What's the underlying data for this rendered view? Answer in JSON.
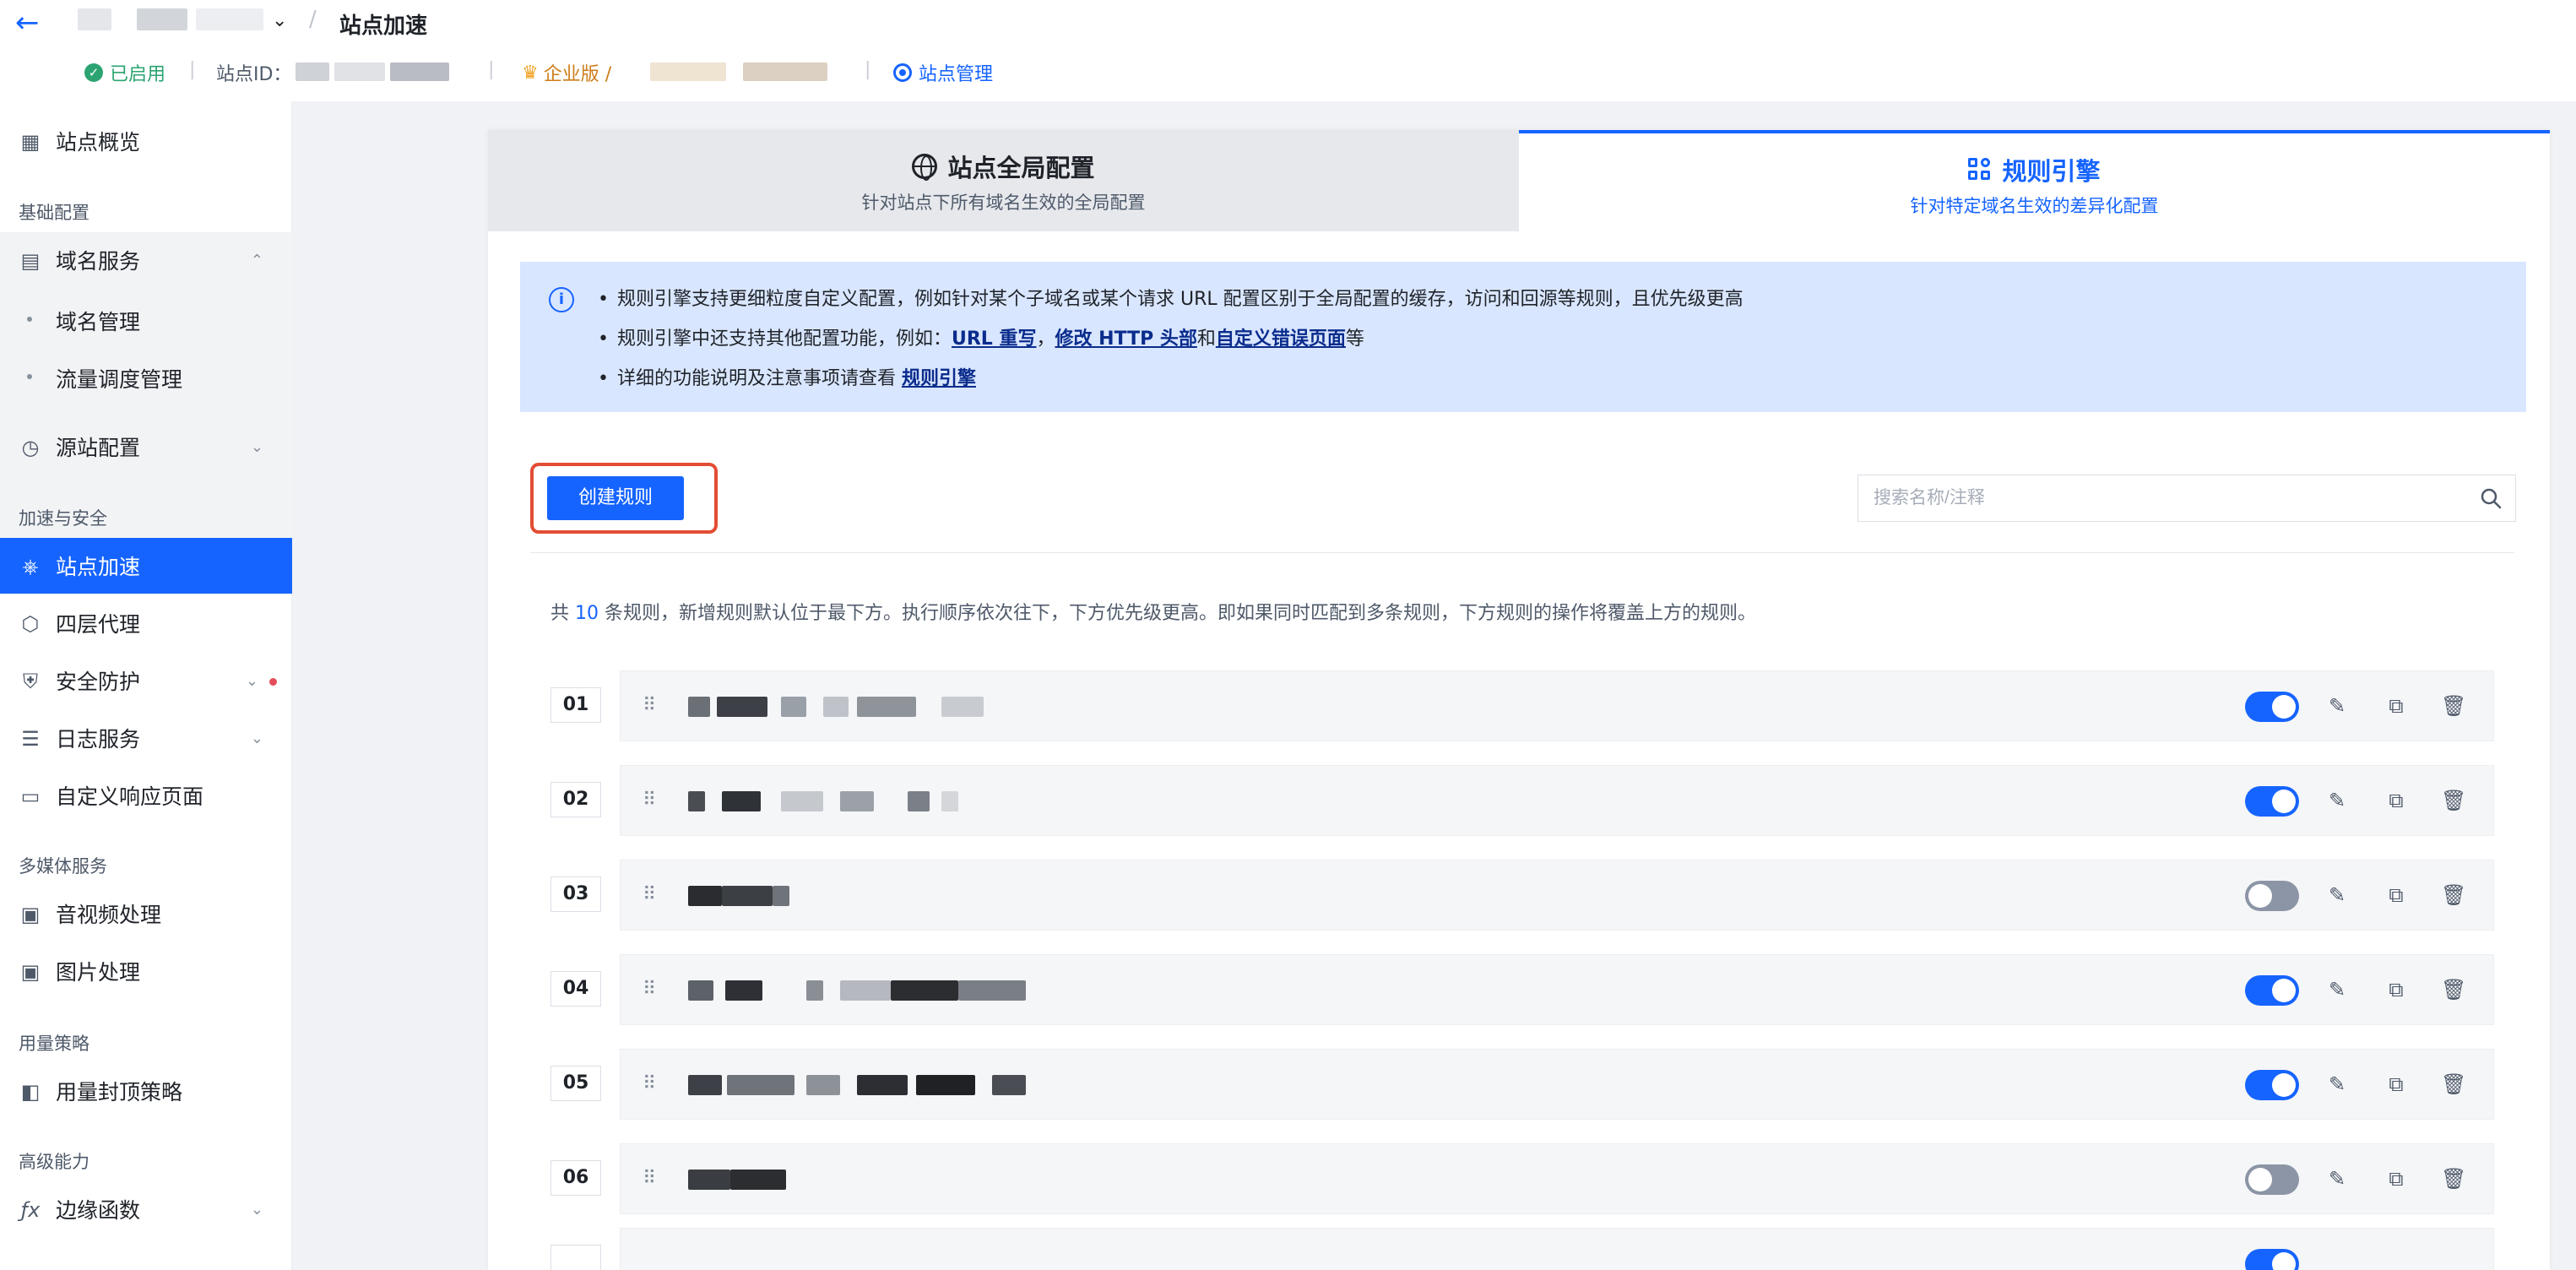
{
  "header": {
    "breadcrumb_separator": "/",
    "page_title": "站点加速",
    "status": "已启用",
    "site_id_label": "站点ID：",
    "edition": "企业版 /",
    "site_management": "站点管理",
    "meta_separator": "|"
  },
  "sidebar": {
    "overview": "站点概览",
    "group_basic": "基础配置",
    "domain_service": "域名服务",
    "domain_management": "域名管理",
    "traffic_scheduling": "流量调度管理",
    "origin_config": "源站配置",
    "group_accel_security": "加速与安全",
    "site_acceleration": "站点加速",
    "l4_proxy": "四层代理",
    "security_protection": "安全防护",
    "log_service": "日志服务",
    "custom_response_page": "自定义响应页面",
    "group_media": "多媒体服务",
    "av_processing": "音视频处理",
    "image_processing": "图片处理",
    "group_usage": "用量策略",
    "usage_cap_policy": "用量封顶策略",
    "group_advanced": "高级能力",
    "edge_functions": "边缘函数"
  },
  "tabs": {
    "global_title": "站点全局配置",
    "global_sub": "针对站点下所有域名生效的全局配置",
    "engine_title": "规则引擎",
    "engine_sub": "针对特定域名生效的差异化配置"
  },
  "info": {
    "line1": "规则引擎支持更细粒度自定义配置，例如针对某个子域名或某个请求 URL 配置区别于全局配置的缓存，访问和回源等规则，且优先级更高",
    "line2_prefix": "规则引擎中还支持其他配置功能，例如：",
    "line2_link1": "URL 重写",
    "line2_comma": "，",
    "line2_link2": "修改 HTTP 头部",
    "line2_and": "和",
    "line2_link3": "自定义错误页面",
    "line2_suffix": "等",
    "line3_prefix": "详细的功能说明及注意事项请查看 ",
    "line3_link": "规则引擎"
  },
  "toolbar": {
    "create_label": "创建规则",
    "search_placeholder": "搜索名称/注释"
  },
  "summary": {
    "prefix": "共 ",
    "count": "10",
    "suffix": " 条规则，新增规则默认位于最下方。执行顺序依次往下，下方优先级更高。即如果同时匹配到多条规则，下方规则的操作将覆盖上方的规则。"
  },
  "rules": [
    {
      "index": "01",
      "enabled": true
    },
    {
      "index": "02",
      "enabled": true
    },
    {
      "index": "03",
      "enabled": false
    },
    {
      "index": "04",
      "enabled": true
    },
    {
      "index": "05",
      "enabled": true
    },
    {
      "index": "06",
      "enabled": false
    }
  ],
  "colors": {
    "accent": "#1664ff",
    "toggle_off": "#8c95a6",
    "highlight": "#e34d35"
  }
}
